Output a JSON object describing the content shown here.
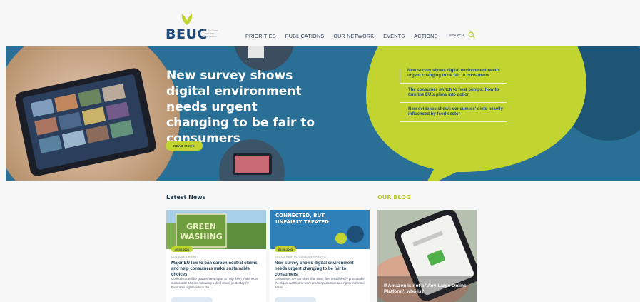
{
  "brand": {
    "name": "BEUC",
    "tagline": "The European Consumer Organisation",
    "green": "#c2d42f",
    "navy": "#1d4a7a",
    "teal": "#2a6f96"
  },
  "nav": {
    "items": [
      "PRIORITIES",
      "PUBLICATIONS",
      "OUR NETWORK",
      "EVENTS",
      "ACTIONS"
    ],
    "search_label": "SEARCH"
  },
  "hero": {
    "title": "New survey shows digital environment needs urgent changing to be fair to consumers",
    "read_more": "READ MORE",
    "links": [
      "New survey shows digital environment needs urgent changing to be fair to consumers",
      "The consumer switch to heat pumps: how to turn the EU's plans into action",
      "New evidence shows consumers' diets heavily influenced by food sector"
    ]
  },
  "latest_news": {
    "title": "Latest News",
    "cards": [
      {
        "image_text": "GREEN WASHING",
        "date": "20.09.2023",
        "category": "CONSUMER RIGHTS",
        "title": "Major EU law to ban carbon neutral claims and help consumers make sustainable choices",
        "excerpt": "Consumers will be granted new rights to help them make more sustainable choices following a deal struck yesterday by European legislators on the ..."
      },
      {
        "image_text": "CONNECTED, BUT UNFAIRLY TREATED",
        "date": "06.09.2023",
        "category": "DIGITAL RIGHTS, CONSUMER RIGHTS",
        "title": "New survey shows digital environment needs urgent changing to be fair to consumers",
        "excerpt": "Consumers are too often ill at ease, feel insufficiently protected in the digital world, and want greater protection and rights in certain areas, ..."
      }
    ]
  },
  "blog": {
    "title": "OUR BLOG",
    "caption": "If Amazon is not a 'Very Large Online Platform', who is?"
  }
}
